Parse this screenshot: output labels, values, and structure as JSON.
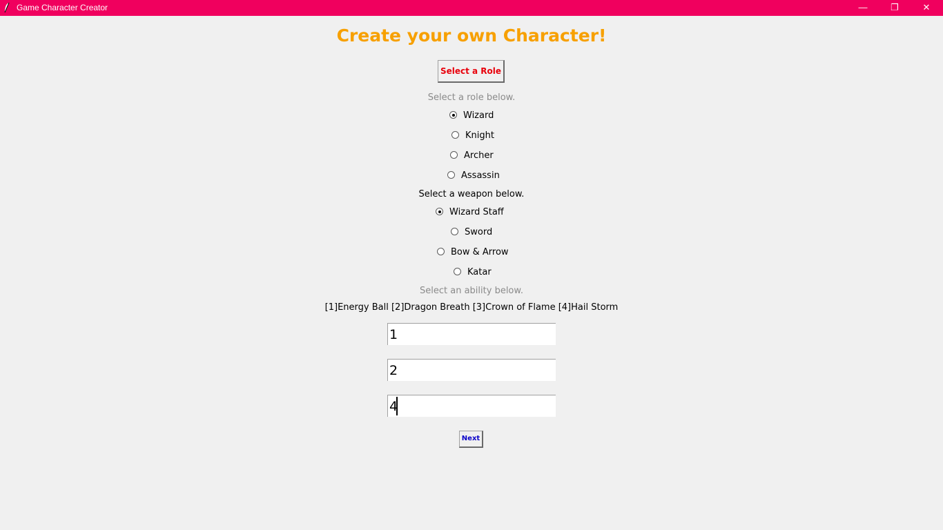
{
  "window": {
    "title": "Game Character Creator",
    "icon": "feather-icon",
    "accent_color": "#f0005e",
    "minimize_glyph": "—",
    "maximize_glyph": "❐",
    "close_glyph": "✕"
  },
  "main": {
    "heading": "Create your own Character!",
    "heading_color": "#f7a000",
    "role_button_label": "Select a Role",
    "role_hint": "Select a role below.",
    "roles": [
      {
        "label": "Wizard",
        "selected": true
      },
      {
        "label": "Knight",
        "selected": false
      },
      {
        "label": "Archer",
        "selected": false
      },
      {
        "label": "Assassin",
        "selected": false
      }
    ],
    "weapon_hint": "Select a weapon below.",
    "weapons": [
      {
        "label": "Wizard Staff",
        "selected": true
      },
      {
        "label": "Sword",
        "selected": false
      },
      {
        "label": "Bow & Arrow",
        "selected": false
      },
      {
        "label": "Katar",
        "selected": false
      }
    ],
    "ability_hint": "Select an ability below.",
    "ability_options": "[1]Energy Ball [2]Dragon Breath [3]Crown of Flame [4]Hail Storm",
    "ability_inputs": [
      "1",
      "2",
      "4"
    ],
    "next_button_label": "Next"
  }
}
